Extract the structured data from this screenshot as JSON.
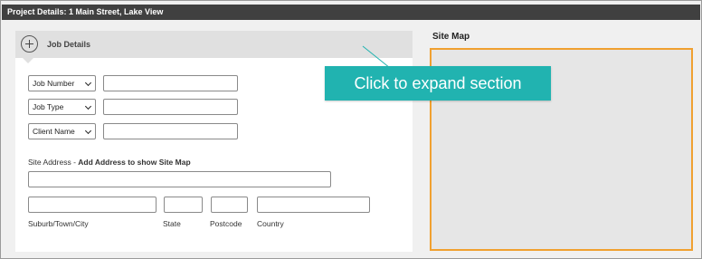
{
  "window": {
    "title": "Project Details: 1 Main Street, Lake View"
  },
  "job_details": {
    "header": "Job Details",
    "fields": [
      {
        "select": "Job Number",
        "value": ""
      },
      {
        "select": "Job Type",
        "value": ""
      },
      {
        "select": "Client Name",
        "value": ""
      }
    ]
  },
  "site_address": {
    "label": "Site Address - ",
    "hint": "Add Address to show Site Map",
    "address_value": "",
    "suburb_label": "Suburb/Town/City",
    "state_label": "State",
    "postcode_label": "Postcode",
    "country_label": "Country"
  },
  "site_map": {
    "title": "Site Map",
    "border_color": "#f0a030"
  },
  "callout": {
    "text": "Click to expand section",
    "color": "#21b3b0"
  },
  "icons": {
    "expand": "plus-circle-icon",
    "dropdown": "chevron-down-icon"
  }
}
